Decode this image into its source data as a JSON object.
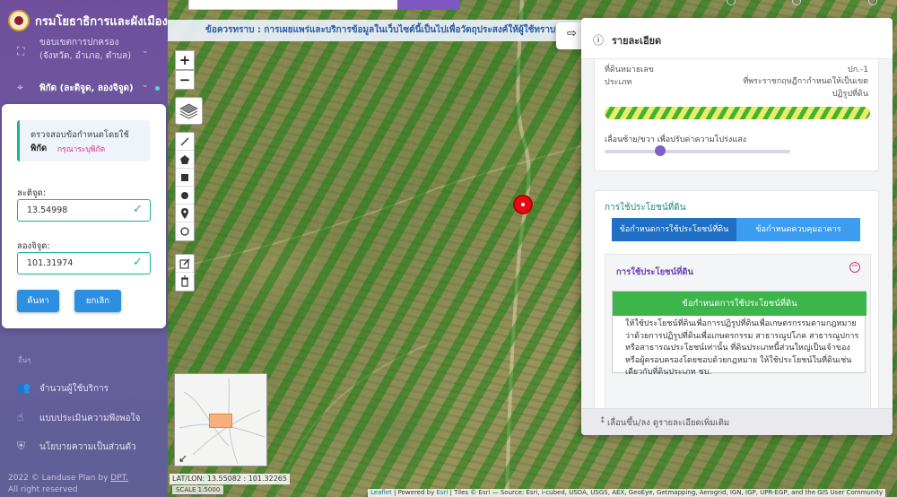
{
  "header": {
    "brand": "กรมโยธาธิการและผังเมือง"
  },
  "sidebar": {
    "nav_admin": "ขอบเขตการปกครอง\n(จังหวัด, อำเภอ, ตำบล)",
    "nav_coord": "พิกัด (ละติจูด, ลองจิจูด)",
    "section_title": "อื่นๆ",
    "links": [
      {
        "label": "จำนวนผู้ใช้บริการ",
        "icon": "users-icon"
      },
      {
        "label": "แบบประเมินความพึงพอใจ",
        "icon": "thumbs-up-icon"
      },
      {
        "label": "นโยบายความเป็นส่วนตัว",
        "icon": "shield-icon"
      }
    ],
    "copyright_line1": "2022 © Landuse Plan by",
    "copyright_link": "DPT.",
    "copyright_line2": "All right reserved"
  },
  "coord_form": {
    "hint_line1": "ตรวจสอบข้อกำหนดโดยใช้",
    "hint_strong": "พิกัด",
    "hint_sub": "กรุณาระบุพิกัด",
    "lat_label": "ละติจูด:",
    "lat_value": "13.54998",
    "lon_label": "ลองจิจูด:",
    "lon_value": "101.31974",
    "search_button": "ค้นหา",
    "cancel_button": "ยกเลิก"
  },
  "map": {
    "notice": "ข้อควรทราบ : การเผยแพร่และบริการข้อมูลในเว็บไซต์นี้เป็นไปเพื่อวัตถุประสงค์ให้ผู้ใช้ทราบถึงข้อมูลเบื้อง",
    "zoom_in": "+",
    "zoom_out": "−",
    "coord_readout": "LAT/LON: 13.55082 : 101.32265",
    "scale": "SCALE 1:5000",
    "attribution_leaflet": "Leaflet",
    "attribution_powered": " | Powered by ",
    "attribution_esri": "Esri",
    "attribution_rest": " | Tiles © Esri — Source: Esri, i-cubed, USDA, USGS, AEX, GeoEye, Getmapping, Aerogrid, IGN, IGP, UPR-EGP, and the GIS User Community"
  },
  "detail": {
    "title": "รายละเอียด",
    "rows": [
      {
        "key": "ที่ดินหมายเลข",
        "value": "ปก.-1"
      },
      {
        "key": "ประเภท",
        "value": "ที่พระราชกฤษฎีกากำหนดให้เป็นเขตปฏิรูปที่ดิน"
      }
    ],
    "opacity_label": "เลื่อนซ้าย/ขวา เพื่อปรับค่าความโปร่งแสง",
    "opacity_value": 0.3,
    "landuse_title": "การใช้ประโยชน์ที่ดิน",
    "tab_landuse": "ข้อกำหนดการใช้ประโยชน์ที่ดิน",
    "tab_building": "ข้อกำหนดควบคุมอาคาร",
    "accordion_title": "การใช้ประโยชน์ที่ดิน",
    "content_head": "ข้อกำหนดการใช้ประโยชน์ที่ดิน",
    "content_text": "ให้ใช้ประโยชน์ที่ดินเพื่อการปฏิรูปที่ดินเพื่อเกษตรกรรมตามกฎหมายว่าด้วยการปฏิรูปที่ดินเพื่อเกษตรกรรม สาธารณูปโภค สาธารณูปการ หรือสาธารณประโยชน์เท่านั้น ที่ดินประเภทนี้ส่วนใหญ่เป็นเจ้าของหรือผู้ครอบครองโดยชอบด้วยกฎหมาย ให้ใช้ประโยชน์ในที่ดินเช่นเดียวกับที่ดินประเภท ชบ.",
    "footer": "เลื่อนขึ้น/ลง ดูรายละเอียดเพิ่มเติม"
  },
  "colors": {
    "sidebar": "#6f4f9c",
    "accent_teal": "#1ab394",
    "button_blue": "#2c8fe0",
    "marker_red": "#e50914",
    "hatch_green": "#44b230",
    "content_green": "#3cb54a"
  }
}
